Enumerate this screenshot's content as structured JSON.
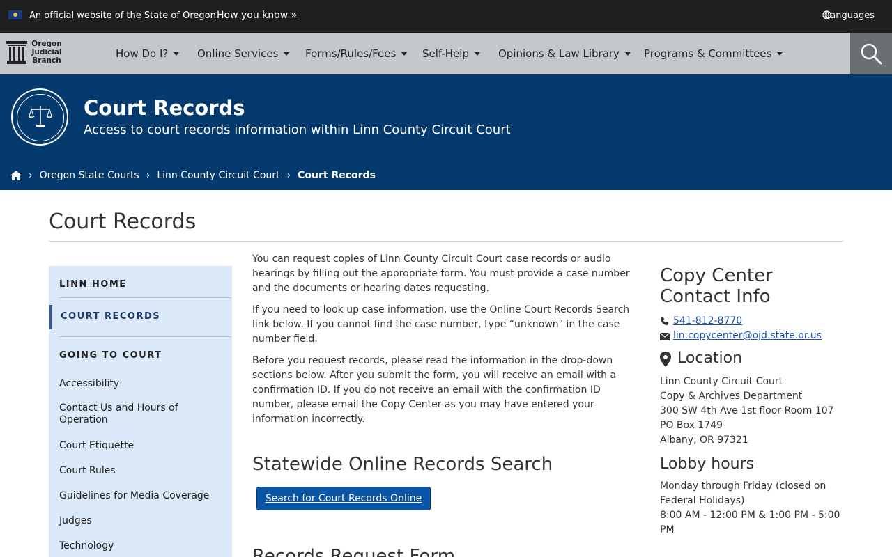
{
  "banner": {
    "official": "An official website of the State of Oregon",
    "how_you_know": "How you know »",
    "languages": "Languages"
  },
  "logo": {
    "line1": "Oregon",
    "line2": "Judicial",
    "line3": "Branch"
  },
  "nav": {
    "items": [
      {
        "label": "How Do I?"
      },
      {
        "label": "Online Services"
      },
      {
        "label": "Forms/Rules/Fees"
      },
      {
        "label": "Self-Help"
      },
      {
        "label": "Opinions & Law Library"
      },
      {
        "label": "Programs & Committees"
      }
    ]
  },
  "hero": {
    "title": "Court Records",
    "subtitle": "Access to court records information within Linn County Circuit Court",
    "breadcrumbs": [
      "Oregon State Courts",
      "Linn County Circuit Court",
      "Court Records"
    ]
  },
  "page": {
    "title": "Court Records"
  },
  "sidebar": {
    "home": "LINN HOME",
    "active": "COURT RECORDS",
    "section": "GOING TO COURT",
    "links": [
      "Accessibility",
      "Contact Us and Hours of Operation",
      "Court Etiquette",
      "Court Rules",
      "Guidelines for Media Coverage",
      "Judges",
      "Technology"
    ]
  },
  "main": {
    "p1": "You can request copies of Linn County Circuit Court case records or audio hearings by filling out the appropriate form. You must provide a case number and the documents or hearing dates requesting.",
    "p2": "If you need to look up case information, use the Online Court Records Search link below. If you cannot find the case number, type “unknown\" in the case number field.",
    "p3": "Before you request records, please read the information in the drop-down sections below. After you submit the form, you will receive an email with a confirmation ID. If you do not receive an email with the confirmation ID number, please email the Copy Center as you may have entered your information incorrectly.",
    "statewide_heading": "Statewide Online Records Search",
    "search_button": "Search for Court Records Online",
    "request_heading": "Records Request Form"
  },
  "aside": {
    "title": "Copy Center Contact Info",
    "phone": "541-812-8770",
    "email": "lin.copycenter@ojd.state.or.us",
    "location_heading": "Location",
    "address": [
      "Linn County Circuit Court",
      "Copy & Archives Department",
      "300 SW 4th Ave 1st floor Room 107",
      "PO Box 1749",
      "Albany, OR 97321"
    ],
    "lobby_heading": "Lobby hours",
    "lobby_days": "Monday through Friday (closed on Federal Holidays)",
    "lobby_times": "8:00 AM - 12:00 PM & 1:00 PM - 5:00 PM"
  }
}
